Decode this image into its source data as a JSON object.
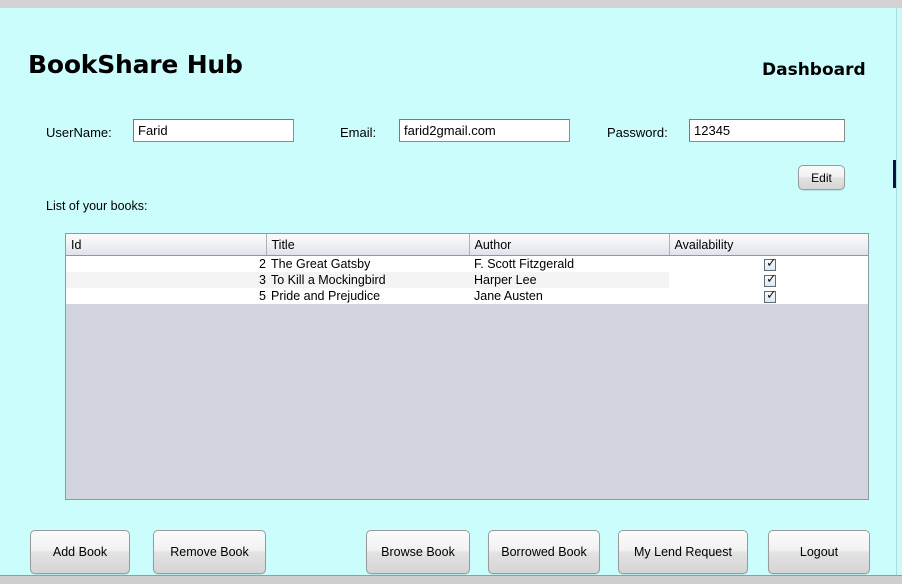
{
  "app": {
    "title": "BookShare Hub",
    "section": "Dashboard",
    "background_color": "#ccfdfd",
    "accent_color": "#000000"
  },
  "form": {
    "username": {
      "label": "UserName:",
      "value": "Farid",
      "placeholder": ""
    },
    "email": {
      "label": "Email:",
      "value": "farid2gmail.com",
      "placeholder": ""
    },
    "password": {
      "label": "Password:",
      "value": "12345",
      "placeholder": ""
    },
    "edit_button": "Edit"
  },
  "books_section": {
    "caption": "List of your books:",
    "columns": [
      "Id",
      "Title",
      "Author",
      "Availability"
    ],
    "rows": [
      {
        "id": "2",
        "title": "The Great Gatsby",
        "author": "F. Scott Fitzgerald",
        "available": true
      },
      {
        "id": "3",
        "title": "To Kill a Mockingbird",
        "author": "Harper Lee",
        "available": true
      },
      {
        "id": "5",
        "title": "Pride and Prejudice",
        "author": "Jane Austen",
        "available": true
      }
    ],
    "check_glyph": "✓"
  },
  "actions": {
    "add_book": "Add Book",
    "remove_book": "Remove Book",
    "browse_book": "Browse Book",
    "borrowed_book": "Borrowed Book",
    "my_lend_request": "My Lend Request",
    "logout": "Logout"
  }
}
